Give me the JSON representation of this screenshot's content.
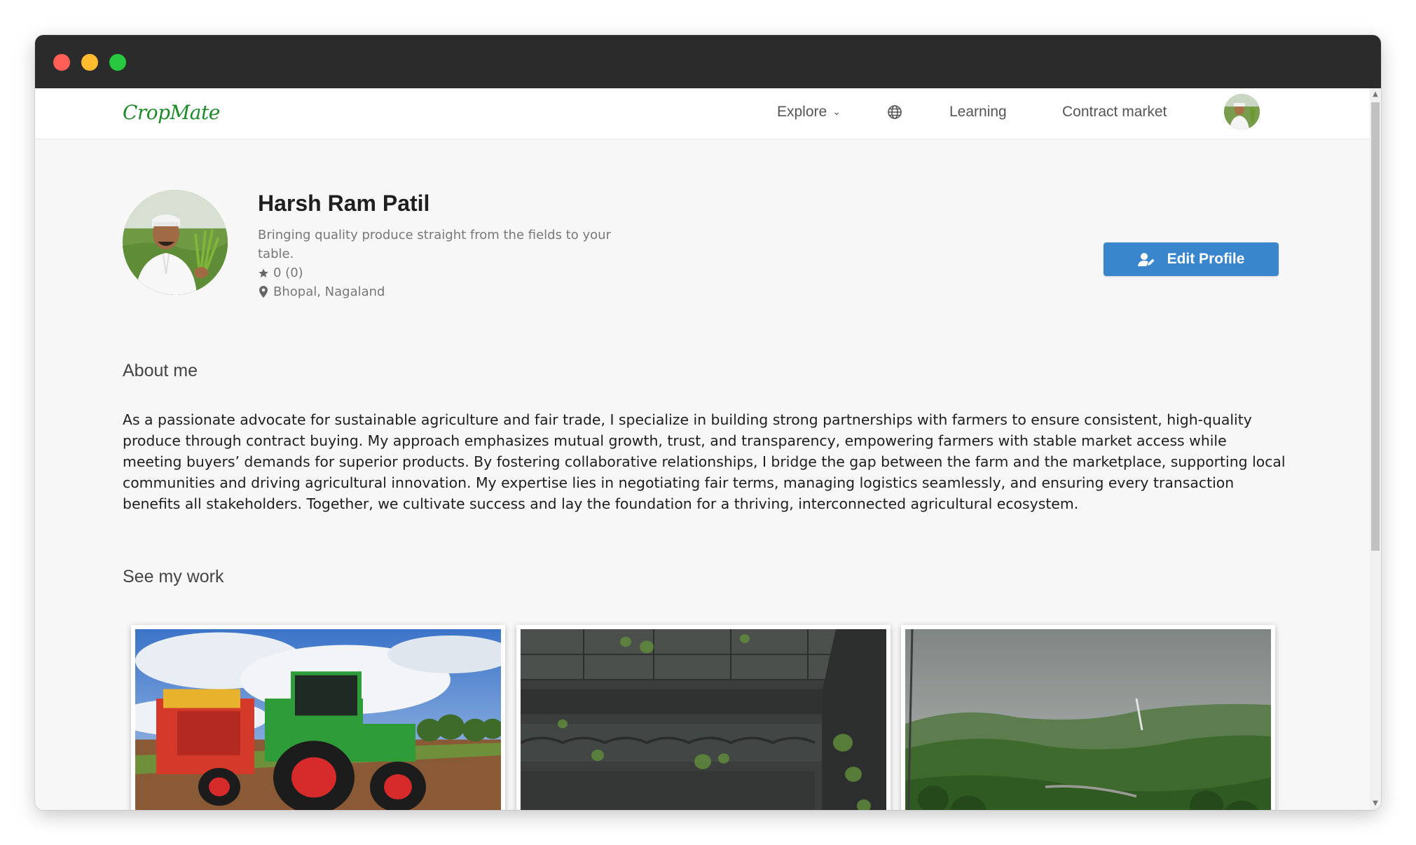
{
  "nav": {
    "brand": "CropMate",
    "explore_label": "Explore",
    "learning_label": "Learning",
    "contract_label": "Contract market"
  },
  "profile": {
    "name": "Harsh Ram Patil",
    "tagline": "Bringing quality produce straight from the fields to your table.",
    "rating": "0 (0)",
    "location": "Bhopal, Nagaland",
    "edit_label": "Edit Profile"
  },
  "about": {
    "title": "About me",
    "text": "As a passionate advocate for sustainable agriculture and fair trade, I specialize in building strong partnerships with farmers to ensure consistent, high-quality produce through contract buying. My approach emphasizes mutual growth, trust, and transparency, empowering farmers with stable market access while meeting buyers’ demands for superior products. By fostering collaborative relationships, I bridge the gap between the farm and the marketplace, supporting local communities and driving agricultural innovation. My expertise lies in negotiating fair terms, managing logistics seamlessly, and ensuring every transaction benefits all stakeholders. Together, we cultivate success and lay the foundation for a thriving, interconnected agricultural ecosystem."
  },
  "work": {
    "title": "See my work",
    "items": [
      {
        "subject": "tractor-with-harvester-photo"
      },
      {
        "subject": "old-stone-wall-photo"
      },
      {
        "subject": "misty-green-hills-photo"
      }
    ]
  },
  "colors": {
    "brand": "#1d8a2a",
    "primary_button": "#3a86cc",
    "titlebar": "#2b2b2b"
  }
}
